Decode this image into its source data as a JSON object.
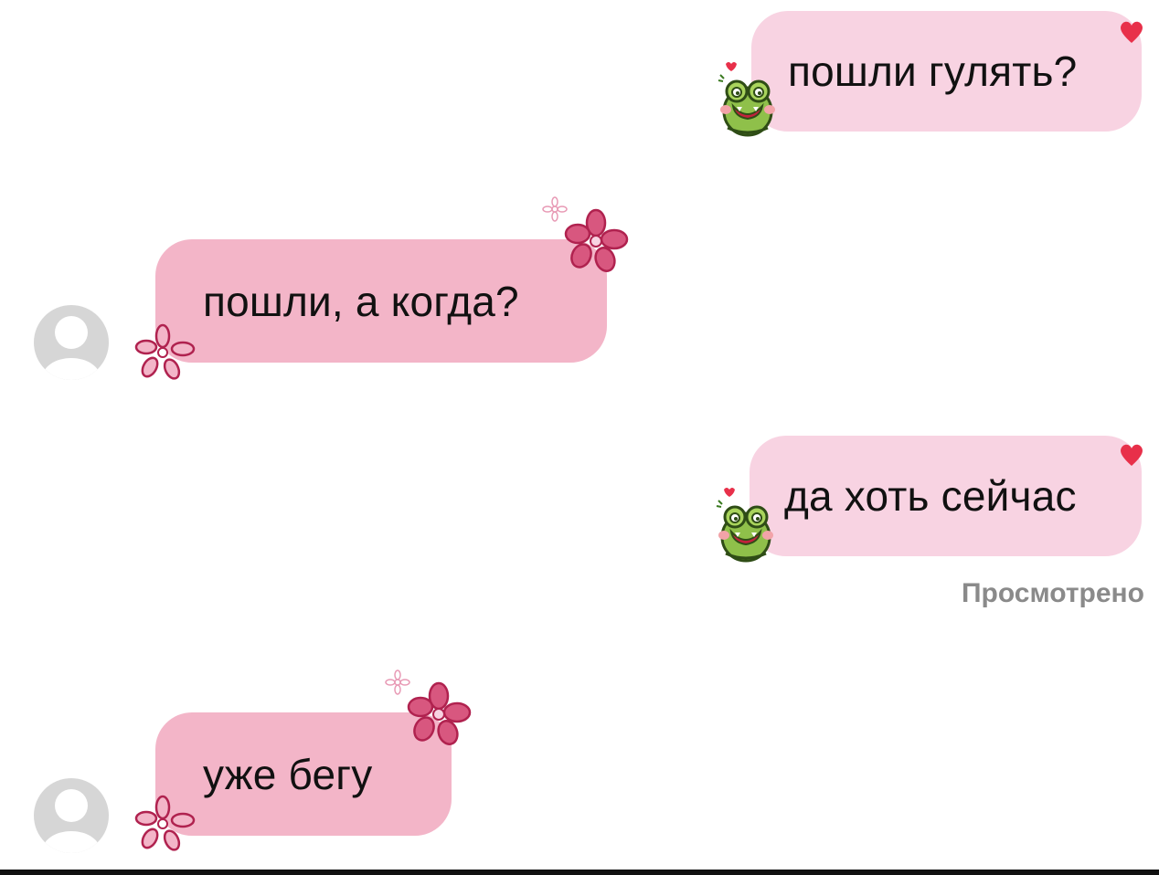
{
  "messages": [
    {
      "direction": "outgoing",
      "text": "пошли гулять?"
    },
    {
      "direction": "incoming",
      "text": "пошли, а когда?"
    },
    {
      "direction": "outgoing",
      "text": "да хоть сейчас"
    },
    {
      "direction": "incoming",
      "text": "уже бегу"
    }
  ],
  "status": {
    "seen_label": "Просмотрено"
  },
  "colors": {
    "outgoing_bubble": "#f8d3e2",
    "incoming_bubble": "#f3b5c8",
    "flower": "#d8577f",
    "heart": "#e8304a",
    "frog": "#8fc04a"
  },
  "icons": {
    "outgoing_sticker": "frog-sticker-icon",
    "incoming_sticker": "flower-sticker-icon",
    "avatar": "default-avatar-icon",
    "heart": "heart-icon"
  }
}
